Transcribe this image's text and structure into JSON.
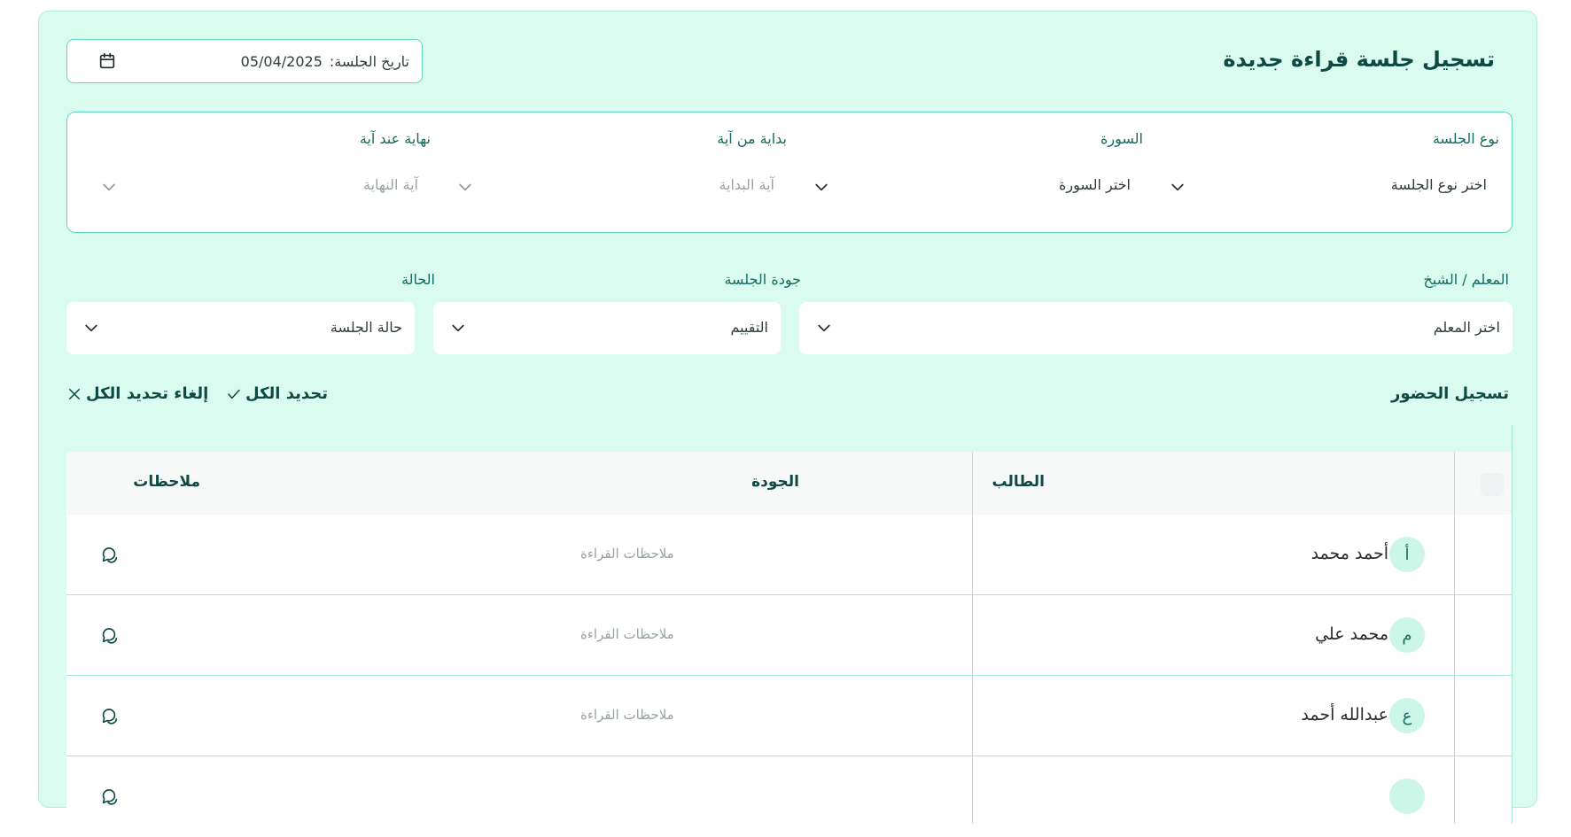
{
  "form": {
    "title": "تسجيل جلسة قراءة جديدة",
    "date_label": "تاريخ الجلسة:",
    "date_value": "05/04/2025"
  },
  "verse_fields": {
    "session_type": {
      "label": "نوع الجلسة",
      "value": "اختر نوع الجلسة"
    },
    "surah": {
      "label": "السورة",
      "value": "اختر السورة"
    },
    "start_ayah": {
      "label": "بداية من آية",
      "placeholder": "آية البداية"
    },
    "end_ayah": {
      "label": "نهاية عند آية",
      "placeholder": "آية النهاية"
    }
  },
  "general_fields": {
    "teacher": {
      "label": "المعلم / الشيخ",
      "value": "اختر المعلم"
    },
    "quality": {
      "label": "جودة الجلسة",
      "value": "التقييم"
    },
    "status": {
      "label": "الحالة",
      "value": "حالة الجلسة"
    }
  },
  "attendance": {
    "title": "تسجيل الحضور",
    "select_all": "تحديد الكل",
    "deselect_all": "إلغاء تحديد الكل"
  },
  "table": {
    "headers": {
      "student": "الطالب",
      "quality": "الجودة",
      "notes": "ملاحظات"
    },
    "rows": [
      {
        "initial": "أ",
        "name": "أحمد محمد",
        "notes_placeholder": "ملاحظات القراءة"
      },
      {
        "initial": "م",
        "name": "محمد علي",
        "notes_placeholder": "ملاحظات القراءة"
      },
      {
        "initial": "ع",
        "name": "عبدالله أحمد",
        "notes_placeholder": "ملاحظات القراءة"
      },
      {
        "initial": "",
        "name": "",
        "notes_placeholder": ""
      }
    ]
  },
  "colors": {
    "card_bg": "#d9fbf0",
    "accent": "#5fd9bc",
    "heading": "#0e4a43"
  },
  "icons": {
    "date": "calendar-icon",
    "dropdown": "chevron-down-icon",
    "select_all": "check-icon",
    "deselect_all": "x-icon",
    "notes": "chat-bubble-icon"
  }
}
